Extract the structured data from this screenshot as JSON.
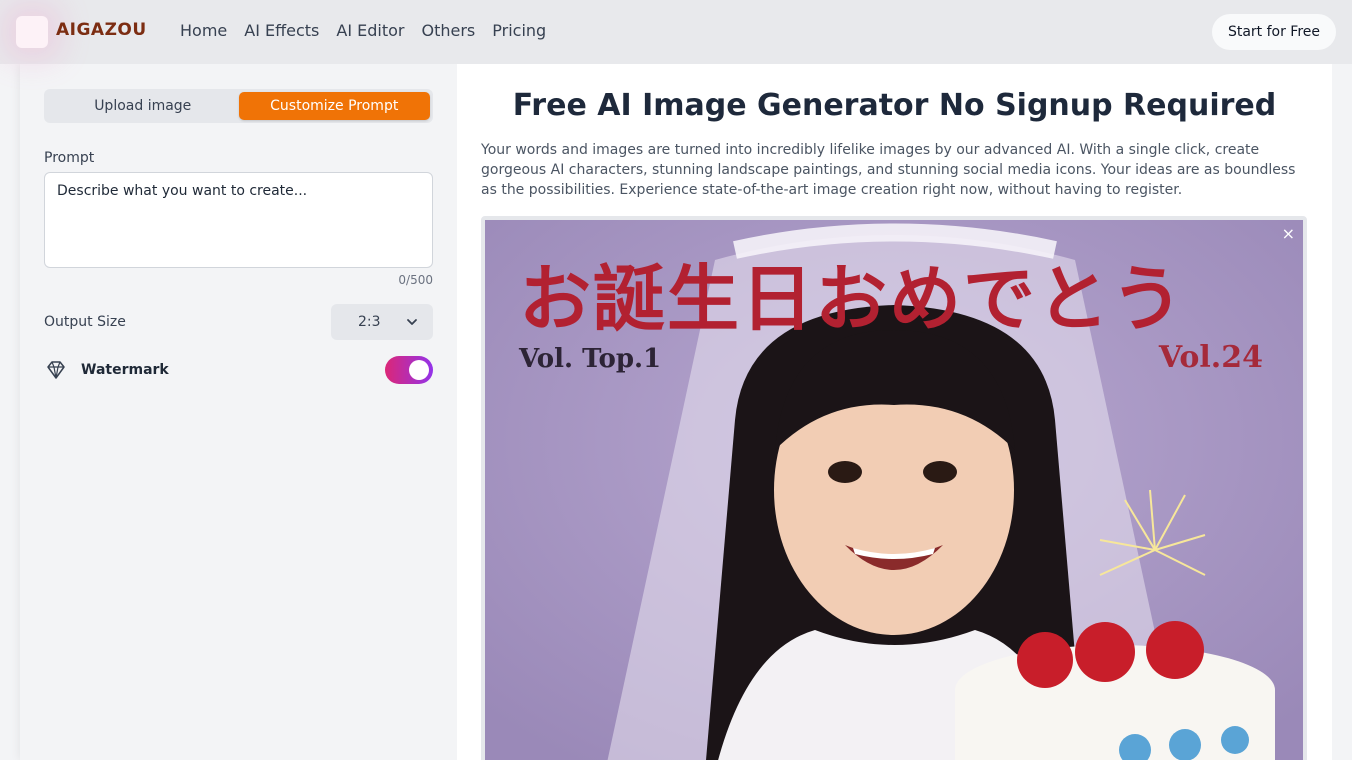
{
  "header": {
    "brand": "AIGAZOU",
    "nav": [
      "Home",
      "AI Effects",
      "AI Editor",
      "Others",
      "Pricing"
    ],
    "cta_label": "Start for Free"
  },
  "left_panel": {
    "tabs": [
      {
        "label": "Upload image",
        "active": false
      },
      {
        "label": "Customize Prompt",
        "active": true
      }
    ],
    "prompt": {
      "label": "Prompt",
      "value": "",
      "placeholder": "Describe what you want to create...",
      "counter": "0/500"
    },
    "output_size": {
      "label": "Output Size",
      "value": "2:3"
    },
    "watermark": {
      "label": "Watermark",
      "enabled": true
    }
  },
  "main": {
    "title": "Free AI Image Generator No Signup Required",
    "description": "Your words and images are turned into incredibly lifelike images by our advanced AI. With a single click, create gorgeous AI characters, stunning landscape paintings, and stunning social media icons. Your ideas are as boundless as the possibilities. Experience state-of-the-art image creation right now, without having to register.",
    "preview": {
      "close_label": "×",
      "headline_jp": "お誕生日おめでとう",
      "vol_left": "Vol. Top.1",
      "vol_right": "Vol.24"
    }
  },
  "colors": {
    "accent_orange": "#f07306",
    "toggle_gradient_start": "#db2777",
    "toggle_gradient_end": "#9333ea",
    "brand_text": "#7c2d12"
  },
  "icons": {
    "watermark": "diamond-icon",
    "output_size_dropdown": "chevron-down-icon"
  }
}
